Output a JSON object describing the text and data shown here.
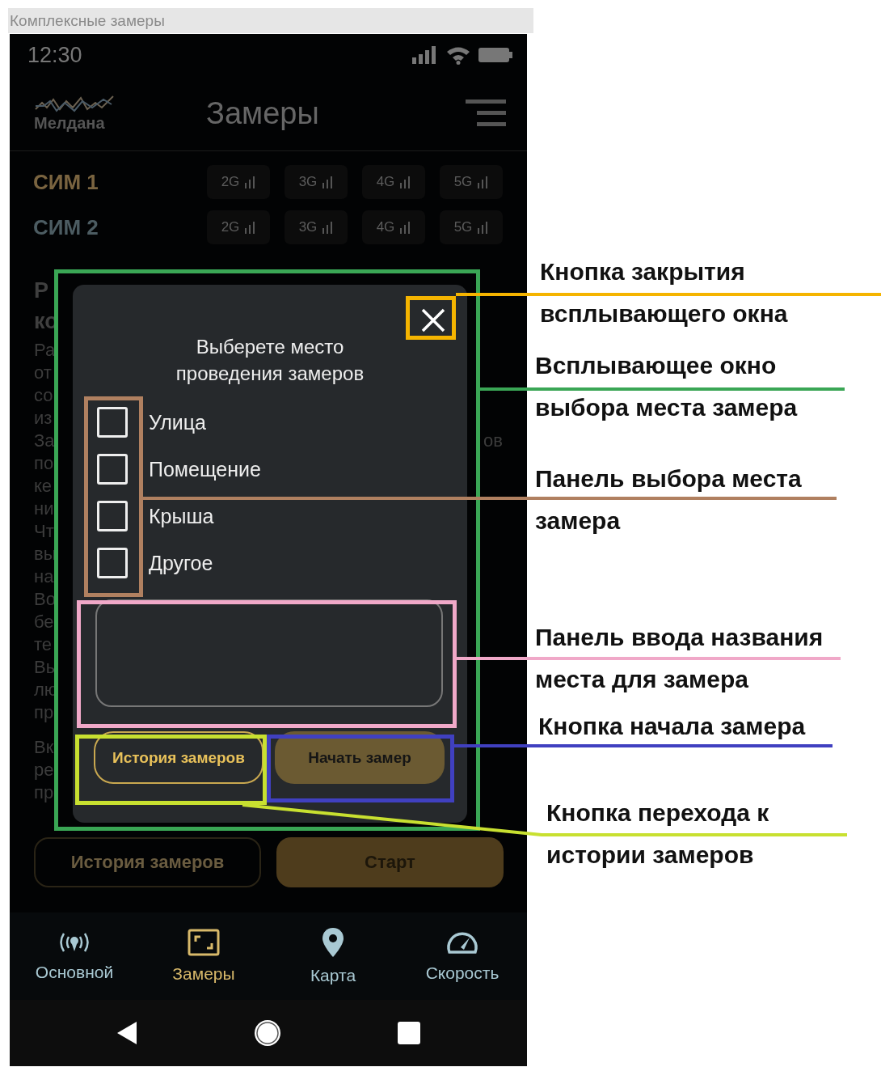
{
  "window": {
    "title": "Комплексные замеры"
  },
  "status_bar": {
    "time": "12:30"
  },
  "app_bar": {
    "logo_text": "Мелдана",
    "title": "Замеры"
  },
  "sim_rows": [
    {
      "label": "СИМ 1",
      "color": "#7a6440",
      "networks": [
        "2G",
        "3G",
        "4G",
        "5G"
      ]
    },
    {
      "label": "СИМ 2",
      "color": "#4c5c62",
      "networks": [
        "2G",
        "3G",
        "4G",
        "5G"
      ]
    }
  ],
  "background_text": {
    "heading_lines": [
      "Р",
      "ко"
    ],
    "body_lines": [
      {
        "text": "Ра"
      },
      {
        "text": "от"
      },
      {
        "text": "со"
      },
      {
        "text": "из"
      },
      {
        "text": "За",
        "tail": "ов"
      },
      {
        "text": "по"
      },
      {
        "text": "ке"
      },
      {
        "text": "ни"
      },
      {
        "text": "Чт"
      },
      {
        "text": "вы"
      },
      {
        "text": "на"
      },
      {
        "text": "Во"
      },
      {
        "text": "бе"
      },
      {
        "text": "те"
      },
      {
        "text": "Вы"
      },
      {
        "text": "лю"
      },
      {
        "text": "пр"
      }
    ],
    "body_lines_2": [
      {
        "text": "Вк"
      },
      {
        "text": "ре"
      },
      {
        "text": "пр"
      }
    ]
  },
  "dialog": {
    "title": "Выберете место проведения замеров",
    "options": [
      {
        "label": "Улица",
        "checked": false
      },
      {
        "label": "Помещение",
        "checked": false
      },
      {
        "label": "Крыша",
        "checked": false
      },
      {
        "label": "Другое",
        "checked": false
      }
    ],
    "buttons": [
      {
        "label": "История замеров",
        "kind": "outline"
      },
      {
        "label": "Начать замер",
        "kind": "filled"
      }
    ]
  },
  "bottom_buttons": [
    {
      "label": "История замеров",
      "kind": "outline"
    },
    {
      "label": "Старт",
      "kind": "filled"
    }
  ],
  "bottom_nav": [
    {
      "label": "Основной",
      "selected": false
    },
    {
      "label": "Замеры",
      "selected": true
    },
    {
      "label": "Карта",
      "selected": false
    },
    {
      "label": "Скорость",
      "selected": false
    }
  ],
  "annotations": [
    {
      "kind": "close",
      "color": "#f5b400",
      "lines": [
        "Кнопка закрытия",
        "всплывающего окна"
      ]
    },
    {
      "kind": "dialog",
      "color": "#3aa655",
      "lines": [
        "Всплывающее окно",
        "выбора места замера"
      ]
    },
    {
      "kind": "options",
      "color": "#b08060",
      "lines": [
        "Панель выбора места",
        "замера"
      ]
    },
    {
      "kind": "field",
      "color": "#f0a8c8",
      "lines": [
        "Панель ввода названия",
        "места для замера"
      ]
    },
    {
      "kind": "start",
      "color": "#4040c0",
      "lines": [
        "Кнопка начала замера"
      ]
    },
    {
      "kind": "history",
      "color": "#c8e030",
      "lines": [
        "Кнопка перехода к",
        "истории замеров"
      ]
    }
  ]
}
